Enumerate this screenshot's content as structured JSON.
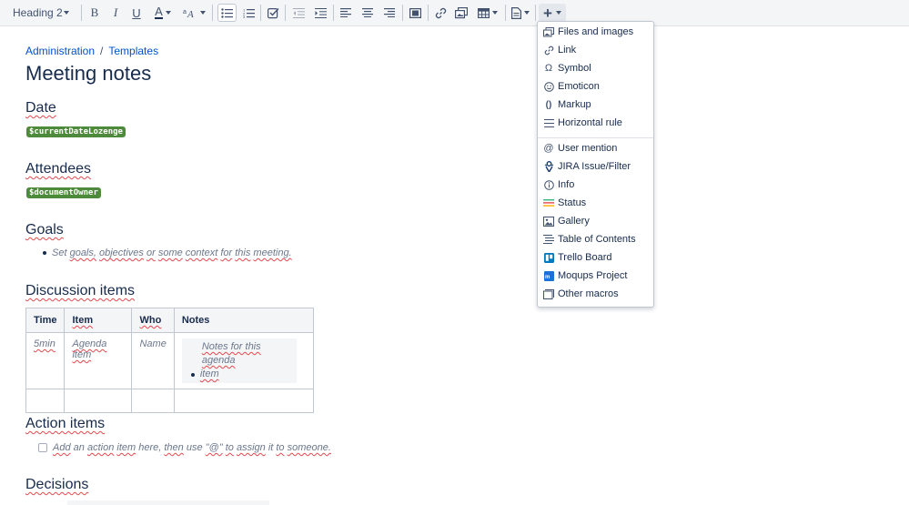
{
  "toolbar": {
    "heading_select": "Heading 2",
    "bold": "B",
    "italic": "I",
    "underline": "U",
    "text_color": "A",
    "insert": "+"
  },
  "breadcrumb": {
    "items": [
      "Administration",
      "Templates"
    ],
    "separator": "/"
  },
  "page_title": "Meeting notes",
  "sections": {
    "date": "Date",
    "attendees": "Attendees",
    "goals": "Goals",
    "discussion": "Discussion items",
    "action": "Action items",
    "decisions": "Decisions"
  },
  "lozenges": {
    "date": "$currentDateLozenge",
    "owner": "$documentOwner"
  },
  "goal_placeholder": [
    "Set",
    "goals,",
    "objectives",
    "or",
    "some",
    "context",
    "for",
    "this",
    "meeting."
  ],
  "table": {
    "headers": [
      "Time",
      "Item",
      "Who",
      "Notes"
    ],
    "row": {
      "time": "5min",
      "item": "Agenda item",
      "who": "Name",
      "notes_line1": "Notes for this agenda",
      "notes_line2": "item"
    }
  },
  "action_placeholder": [
    "Add",
    "an",
    "action",
    "item",
    "here,",
    "then",
    "use",
    "\"@\"",
    "to",
    "assign",
    "it",
    "to",
    "someone."
  ],
  "insert_menu": {
    "group1": [
      "Files and images",
      "Link",
      "Symbol",
      "Emoticon",
      "Markup",
      "Horizontal rule"
    ],
    "group2": [
      "User mention",
      "JIRA Issue/Filter",
      "Info",
      "Status",
      "Gallery",
      "Table of Contents",
      "Trello Board",
      "Moqups Project",
      "Other macros"
    ]
  },
  "colors": {
    "link": "#0052cc",
    "lozenge": "#4e8a3b",
    "trello": "#0079bf",
    "moqups": "#1e6fd9",
    "status": "#e5484d"
  }
}
